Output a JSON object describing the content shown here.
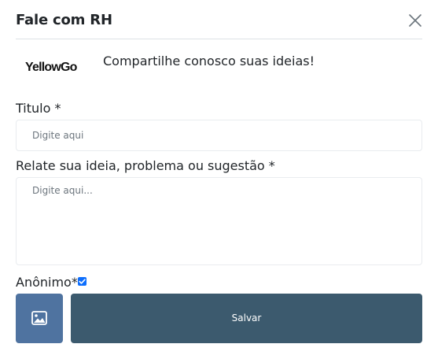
{
  "modal": {
    "title": "Fale com RH"
  },
  "brand": {
    "logo_text": "YellowGo",
    "tagline": "Compartilhe conosco suas ideias!"
  },
  "form": {
    "title_label": "Titulo *",
    "title_placeholder": "Digite aqui",
    "title_value": "",
    "idea_label": "Relate sua ideia, problema ou sugestão *",
    "idea_placeholder": "Digite aqui...",
    "idea_value": "",
    "anonymous_label": "Anônimo*",
    "anonymous_checked": true
  },
  "actions": {
    "image_button_icon": "image-icon",
    "save_label": "Salvar"
  },
  "colors": {
    "image_button_bg": "#4f73a0",
    "save_button_bg": "#3c5a6e",
    "checkbox_accent": "#0d6efd"
  }
}
